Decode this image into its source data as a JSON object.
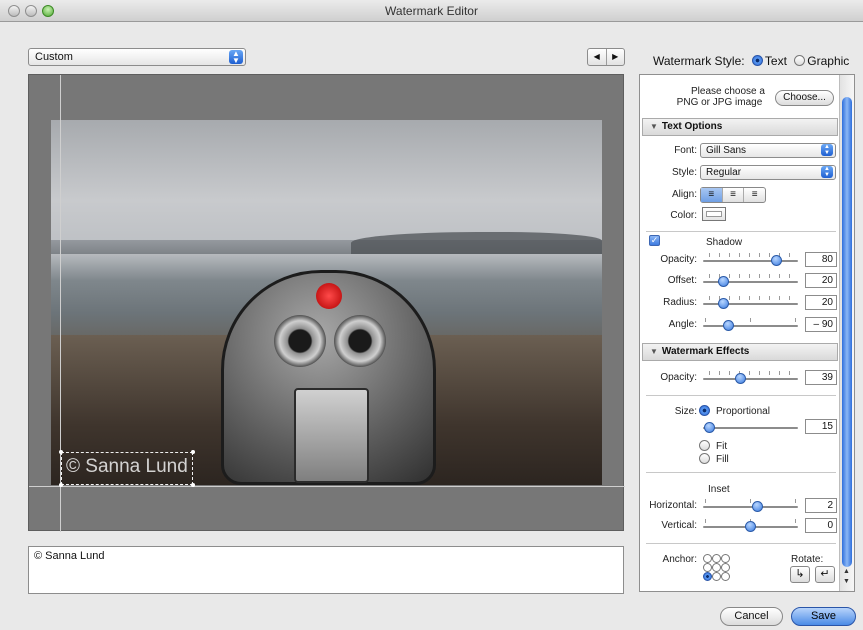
{
  "window": {
    "title": "Watermark Editor"
  },
  "preset": {
    "value": "Custom"
  },
  "nav": {
    "prev": "◀",
    "next": "▶"
  },
  "watermark_style": {
    "label": "Watermark Style:",
    "text_option": "Text",
    "graphic_option": "Graphic",
    "selected": "Text"
  },
  "preview": {
    "watermark_text": "© Sanna Lund"
  },
  "text_input": {
    "value": "© Sanna Lund"
  },
  "image_choose": {
    "prompt_line1": "Please choose a",
    "prompt_line2": "PNG or JPG image",
    "button": "Choose..."
  },
  "text_options": {
    "header": "Text Options",
    "font_label": "Font:",
    "font_value": "Gill Sans",
    "style_label": "Style:",
    "style_value": "Regular",
    "align_label": "Align:",
    "align_icons": [
      "align-left-icon",
      "align-center-icon",
      "align-right-icon"
    ],
    "color_label": "Color:"
  },
  "shadow": {
    "label": "Shadow",
    "enabled": true,
    "opacity_label": "Opacity:",
    "opacity": "80",
    "offset_label": "Offset:",
    "offset": "20",
    "radius_label": "Radius:",
    "radius": "20",
    "angle_label": "Angle:",
    "angle": "– 90"
  },
  "effects": {
    "header": "Watermark Effects",
    "opacity_label": "Opacity:",
    "opacity": "39",
    "size_label": "Size:",
    "size_proportional": "Proportional",
    "size_value": "15",
    "size_fit": "Fit",
    "size_fill": "Fill",
    "inset_label": "Inset",
    "horizontal_label": "Horizontal:",
    "horizontal": "2",
    "vertical_label": "Vertical:",
    "vertical": "0",
    "anchor_label": "Anchor:",
    "rotate_label": "Rotate:"
  },
  "footer": {
    "cancel": "Cancel",
    "save": "Save"
  }
}
